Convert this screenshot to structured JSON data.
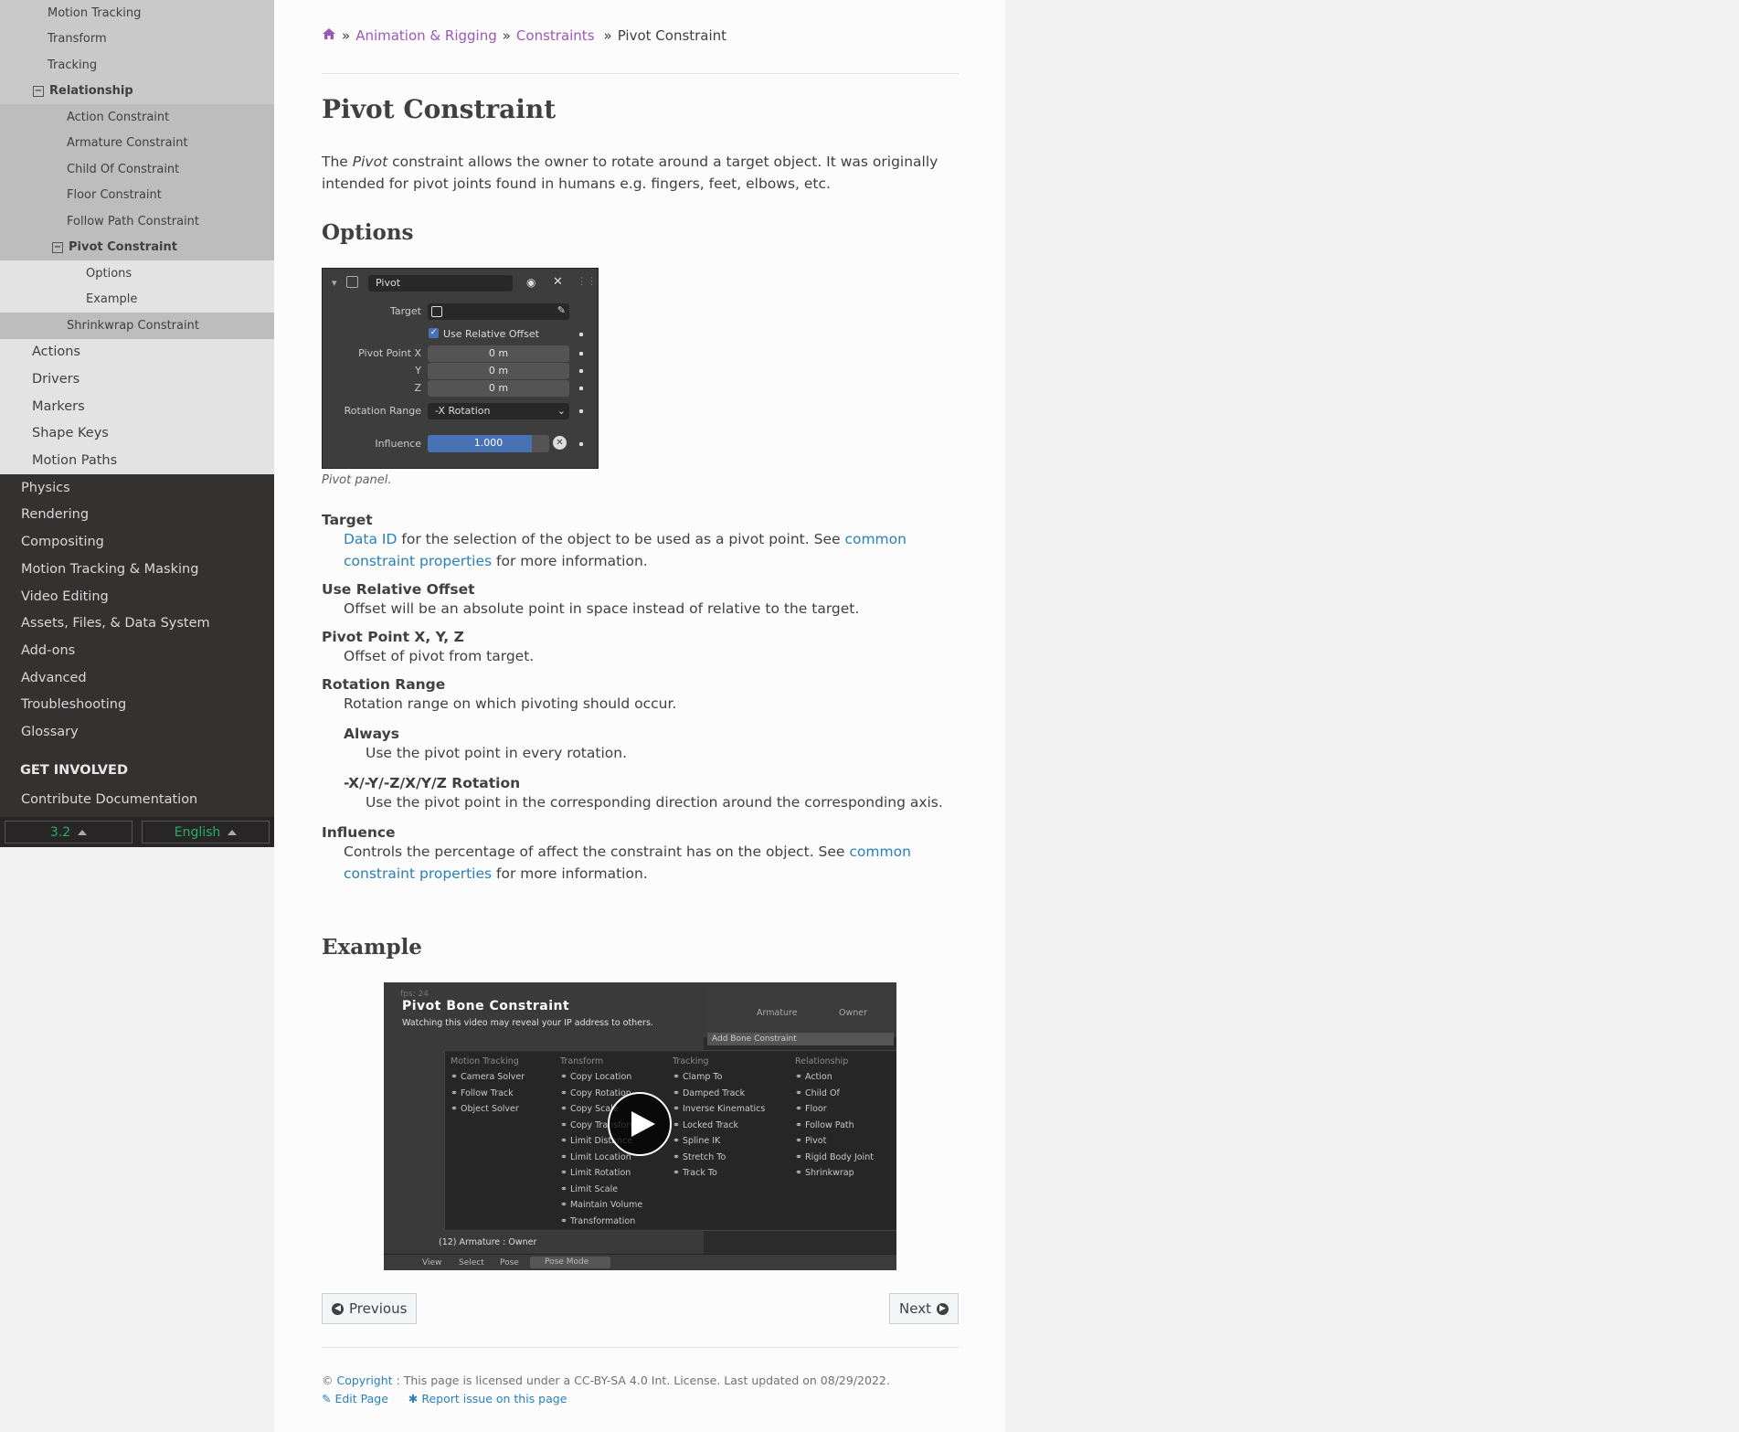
{
  "sidebar": {
    "level3_top": [
      "Motion Tracking",
      "Transform",
      "Tracking"
    ],
    "relationship": "Relationship",
    "relationship_items": [
      "Action Constraint",
      "Armature Constraint",
      "Child Of Constraint",
      "Floor Constraint",
      "Follow Path Constraint"
    ],
    "pivot_constraint": "Pivot Constraint",
    "pivot_sub": [
      "Options",
      "Example"
    ],
    "shrinkwrap": "Shrinkwrap Constraint",
    "level2": [
      "Actions",
      "Drivers",
      "Markers",
      "Shape Keys",
      "Motion Paths"
    ],
    "level1": [
      "Physics",
      "Rendering",
      "Compositing",
      "Motion Tracking & Masking",
      "Video Editing",
      "Assets, Files, & Data System",
      "Add-ons",
      "Advanced",
      "Troubleshooting",
      "Glossary"
    ],
    "get_involved": "GET INVOLVED",
    "contribute": "Contribute Documentation",
    "version": "3.2",
    "language": "English"
  },
  "breadcrumb": {
    "sep": "»",
    "items": [
      "Animation & Rigging",
      "Constraints"
    ],
    "current": "Pivot Constraint"
  },
  "page": {
    "title": "Pivot Constraint",
    "intro_before": "The ",
    "intro_em": "Pivot",
    "intro_after": " constraint allows the owner to rotate around a target object. It was originally intended for pivot joints found in humans e.g. fingers, feet, elbows, etc.",
    "options_heading": "Options",
    "panel": {
      "name": "Pivot",
      "target_label": "Target",
      "use_relative_offset": "Use Relative Offset",
      "pivot_x_label": "Pivot Point X",
      "y_label": "Y",
      "z_label": "Z",
      "pivot_x": "0 m",
      "pivot_y": "0 m",
      "pivot_z": "0 m",
      "rotation_range_label": "Rotation Range",
      "rotation_range": "-X Rotation",
      "influence_label": "Influence",
      "influence": "1.000",
      "influence_fraction": 0.86
    },
    "panel_caption": "Pivot panel.",
    "defs": {
      "target_term": "Target",
      "target_link1": "Data ID",
      "target_text": " for the selection of the object to be used as a pivot point. See ",
      "target_link2": "common constraint properties",
      "target_tail": " for more information.",
      "relative_term": "Use Relative Offset",
      "relative_desc": "Offset will be an absolute point in space instead of relative to the target.",
      "pivot_term": "Pivot Point X, Y, Z",
      "pivot_desc": "Offset of pivot from target.",
      "rotation_term": "Rotation Range",
      "rotation_desc": "Rotation range on which pivoting should occur.",
      "always_term": "Always",
      "always_desc": "Use the pivot point in every rotation.",
      "axis_term": "-X/-Y/-Z/X/Y/Z Rotation",
      "axis_desc": "Use the pivot point in the corresponding direction around the corresponding axis.",
      "influence_term": "Influence",
      "influence_text": "Controls the percentage of affect the constraint has on the object. See ",
      "influence_link": "common constraint properties",
      "influence_tail": " for more information."
    },
    "example_heading": "Example",
    "video": {
      "title": "Pivot Bone Constraint",
      "notice": "Watching this video may reveal your IP address to others.",
      "fps": "fps: 24",
      "header_armature": "Armature",
      "header_owner": "Owner",
      "add_bone_constraint": "Add Bone Constraint",
      "columns": [
        {
          "heading": "Motion Tracking",
          "items": [
            "Camera Solver",
            "Follow Track",
            "Object Solver"
          ]
        },
        {
          "heading": "Transform",
          "items": [
            "Copy Location",
            "Copy Rotation",
            "Copy Scale",
            "Copy Transforms",
            "Limit Distance",
            "Limit Location",
            "Limit Rotation",
            "Limit Scale",
            "Maintain Volume",
            "Transformation"
          ]
        },
        {
          "heading": "Tracking",
          "items": [
            "Clamp To",
            "Damped Track",
            "Inverse Kinematics",
            "Locked Track",
            "Spline IK",
            "Stretch To",
            "Track To"
          ]
        },
        {
          "heading": "Relationship",
          "items": [
            "Action",
            "Child Of",
            "Floor",
            "Follow Path",
            "Pivot",
            "Rigid Body Joint",
            "Shrinkwrap"
          ]
        }
      ],
      "status": "(12) Armature : Owner",
      "bottom_menu": [
        "View",
        "Select",
        "Pose"
      ],
      "mode": "Pose Mode"
    },
    "prev": "Previous",
    "next": "Next"
  },
  "footer": {
    "copy_symbol": "©",
    "copyright_link": "Copyright",
    "license_text": ": This page is licensed under a CC-BY-SA 4.0 Int. License. Last updated on 08/29/2022.",
    "edit_page": "Edit Page",
    "report_issue": "Report issue on this page"
  },
  "colors": {
    "link": "#2980b9",
    "visited": "#9b59b6",
    "sidebar_dark": "#343131",
    "version_green": "#27ae60",
    "influence_blue": "#4772b3"
  }
}
